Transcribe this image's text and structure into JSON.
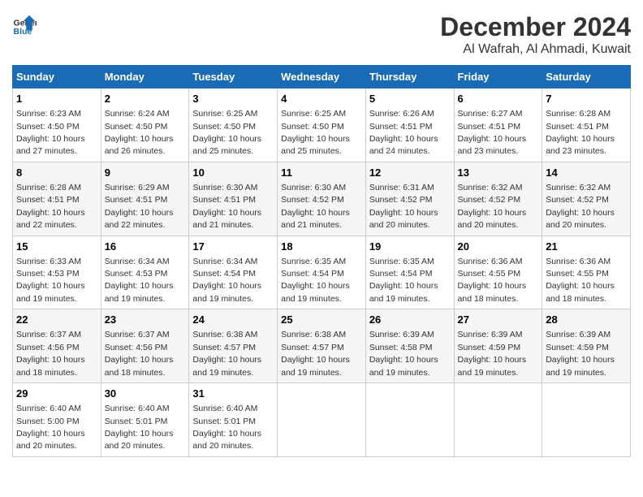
{
  "logo": {
    "general": "General",
    "blue": "Blue"
  },
  "title": "December 2024",
  "location": "Al Wafrah, Al Ahmadi, Kuwait",
  "days_of_week": [
    "Sunday",
    "Monday",
    "Tuesday",
    "Wednesday",
    "Thursday",
    "Friday",
    "Saturday"
  ],
  "weeks": [
    [
      {
        "day": "1",
        "sunrise": "6:23 AM",
        "sunset": "4:50 PM",
        "daylight": "10 hours and 27 minutes."
      },
      {
        "day": "2",
        "sunrise": "6:24 AM",
        "sunset": "4:50 PM",
        "daylight": "10 hours and 26 minutes."
      },
      {
        "day": "3",
        "sunrise": "6:25 AM",
        "sunset": "4:50 PM",
        "daylight": "10 hours and 25 minutes."
      },
      {
        "day": "4",
        "sunrise": "6:25 AM",
        "sunset": "4:50 PM",
        "daylight": "10 hours and 25 minutes."
      },
      {
        "day": "5",
        "sunrise": "6:26 AM",
        "sunset": "4:51 PM",
        "daylight": "10 hours and 24 minutes."
      },
      {
        "day": "6",
        "sunrise": "6:27 AM",
        "sunset": "4:51 PM",
        "daylight": "10 hours and 23 minutes."
      },
      {
        "day": "7",
        "sunrise": "6:28 AM",
        "sunset": "4:51 PM",
        "daylight": "10 hours and 23 minutes."
      }
    ],
    [
      {
        "day": "8",
        "sunrise": "6:28 AM",
        "sunset": "4:51 PM",
        "daylight": "10 hours and 22 minutes."
      },
      {
        "day": "9",
        "sunrise": "6:29 AM",
        "sunset": "4:51 PM",
        "daylight": "10 hours and 22 minutes."
      },
      {
        "day": "10",
        "sunrise": "6:30 AM",
        "sunset": "4:51 PM",
        "daylight": "10 hours and 21 minutes."
      },
      {
        "day": "11",
        "sunrise": "6:30 AM",
        "sunset": "4:52 PM",
        "daylight": "10 hours and 21 minutes."
      },
      {
        "day": "12",
        "sunrise": "6:31 AM",
        "sunset": "4:52 PM",
        "daylight": "10 hours and 20 minutes."
      },
      {
        "day": "13",
        "sunrise": "6:32 AM",
        "sunset": "4:52 PM",
        "daylight": "10 hours and 20 minutes."
      },
      {
        "day": "14",
        "sunrise": "6:32 AM",
        "sunset": "4:52 PM",
        "daylight": "10 hours and 20 minutes."
      }
    ],
    [
      {
        "day": "15",
        "sunrise": "6:33 AM",
        "sunset": "4:53 PM",
        "daylight": "10 hours and 19 minutes."
      },
      {
        "day": "16",
        "sunrise": "6:34 AM",
        "sunset": "4:53 PM",
        "daylight": "10 hours and 19 minutes."
      },
      {
        "day": "17",
        "sunrise": "6:34 AM",
        "sunset": "4:54 PM",
        "daylight": "10 hours and 19 minutes."
      },
      {
        "day": "18",
        "sunrise": "6:35 AM",
        "sunset": "4:54 PM",
        "daylight": "10 hours and 19 minutes."
      },
      {
        "day": "19",
        "sunrise": "6:35 AM",
        "sunset": "4:54 PM",
        "daylight": "10 hours and 19 minutes."
      },
      {
        "day": "20",
        "sunrise": "6:36 AM",
        "sunset": "4:55 PM",
        "daylight": "10 hours and 18 minutes."
      },
      {
        "day": "21",
        "sunrise": "6:36 AM",
        "sunset": "4:55 PM",
        "daylight": "10 hours and 18 minutes."
      }
    ],
    [
      {
        "day": "22",
        "sunrise": "6:37 AM",
        "sunset": "4:56 PM",
        "daylight": "10 hours and 18 minutes."
      },
      {
        "day": "23",
        "sunrise": "6:37 AM",
        "sunset": "4:56 PM",
        "daylight": "10 hours and 18 minutes."
      },
      {
        "day": "24",
        "sunrise": "6:38 AM",
        "sunset": "4:57 PM",
        "daylight": "10 hours and 19 minutes."
      },
      {
        "day": "25",
        "sunrise": "6:38 AM",
        "sunset": "4:57 PM",
        "daylight": "10 hours and 19 minutes."
      },
      {
        "day": "26",
        "sunrise": "6:39 AM",
        "sunset": "4:58 PM",
        "daylight": "10 hours and 19 minutes."
      },
      {
        "day": "27",
        "sunrise": "6:39 AM",
        "sunset": "4:59 PM",
        "daylight": "10 hours and 19 minutes."
      },
      {
        "day": "28",
        "sunrise": "6:39 AM",
        "sunset": "4:59 PM",
        "daylight": "10 hours and 19 minutes."
      }
    ],
    [
      {
        "day": "29",
        "sunrise": "6:40 AM",
        "sunset": "5:00 PM",
        "daylight": "10 hours and 20 minutes."
      },
      {
        "day": "30",
        "sunrise": "6:40 AM",
        "sunset": "5:01 PM",
        "daylight": "10 hours and 20 minutes."
      },
      {
        "day": "31",
        "sunrise": "6:40 AM",
        "sunset": "5:01 PM",
        "daylight": "10 hours and 20 minutes."
      },
      null,
      null,
      null,
      null
    ]
  ]
}
